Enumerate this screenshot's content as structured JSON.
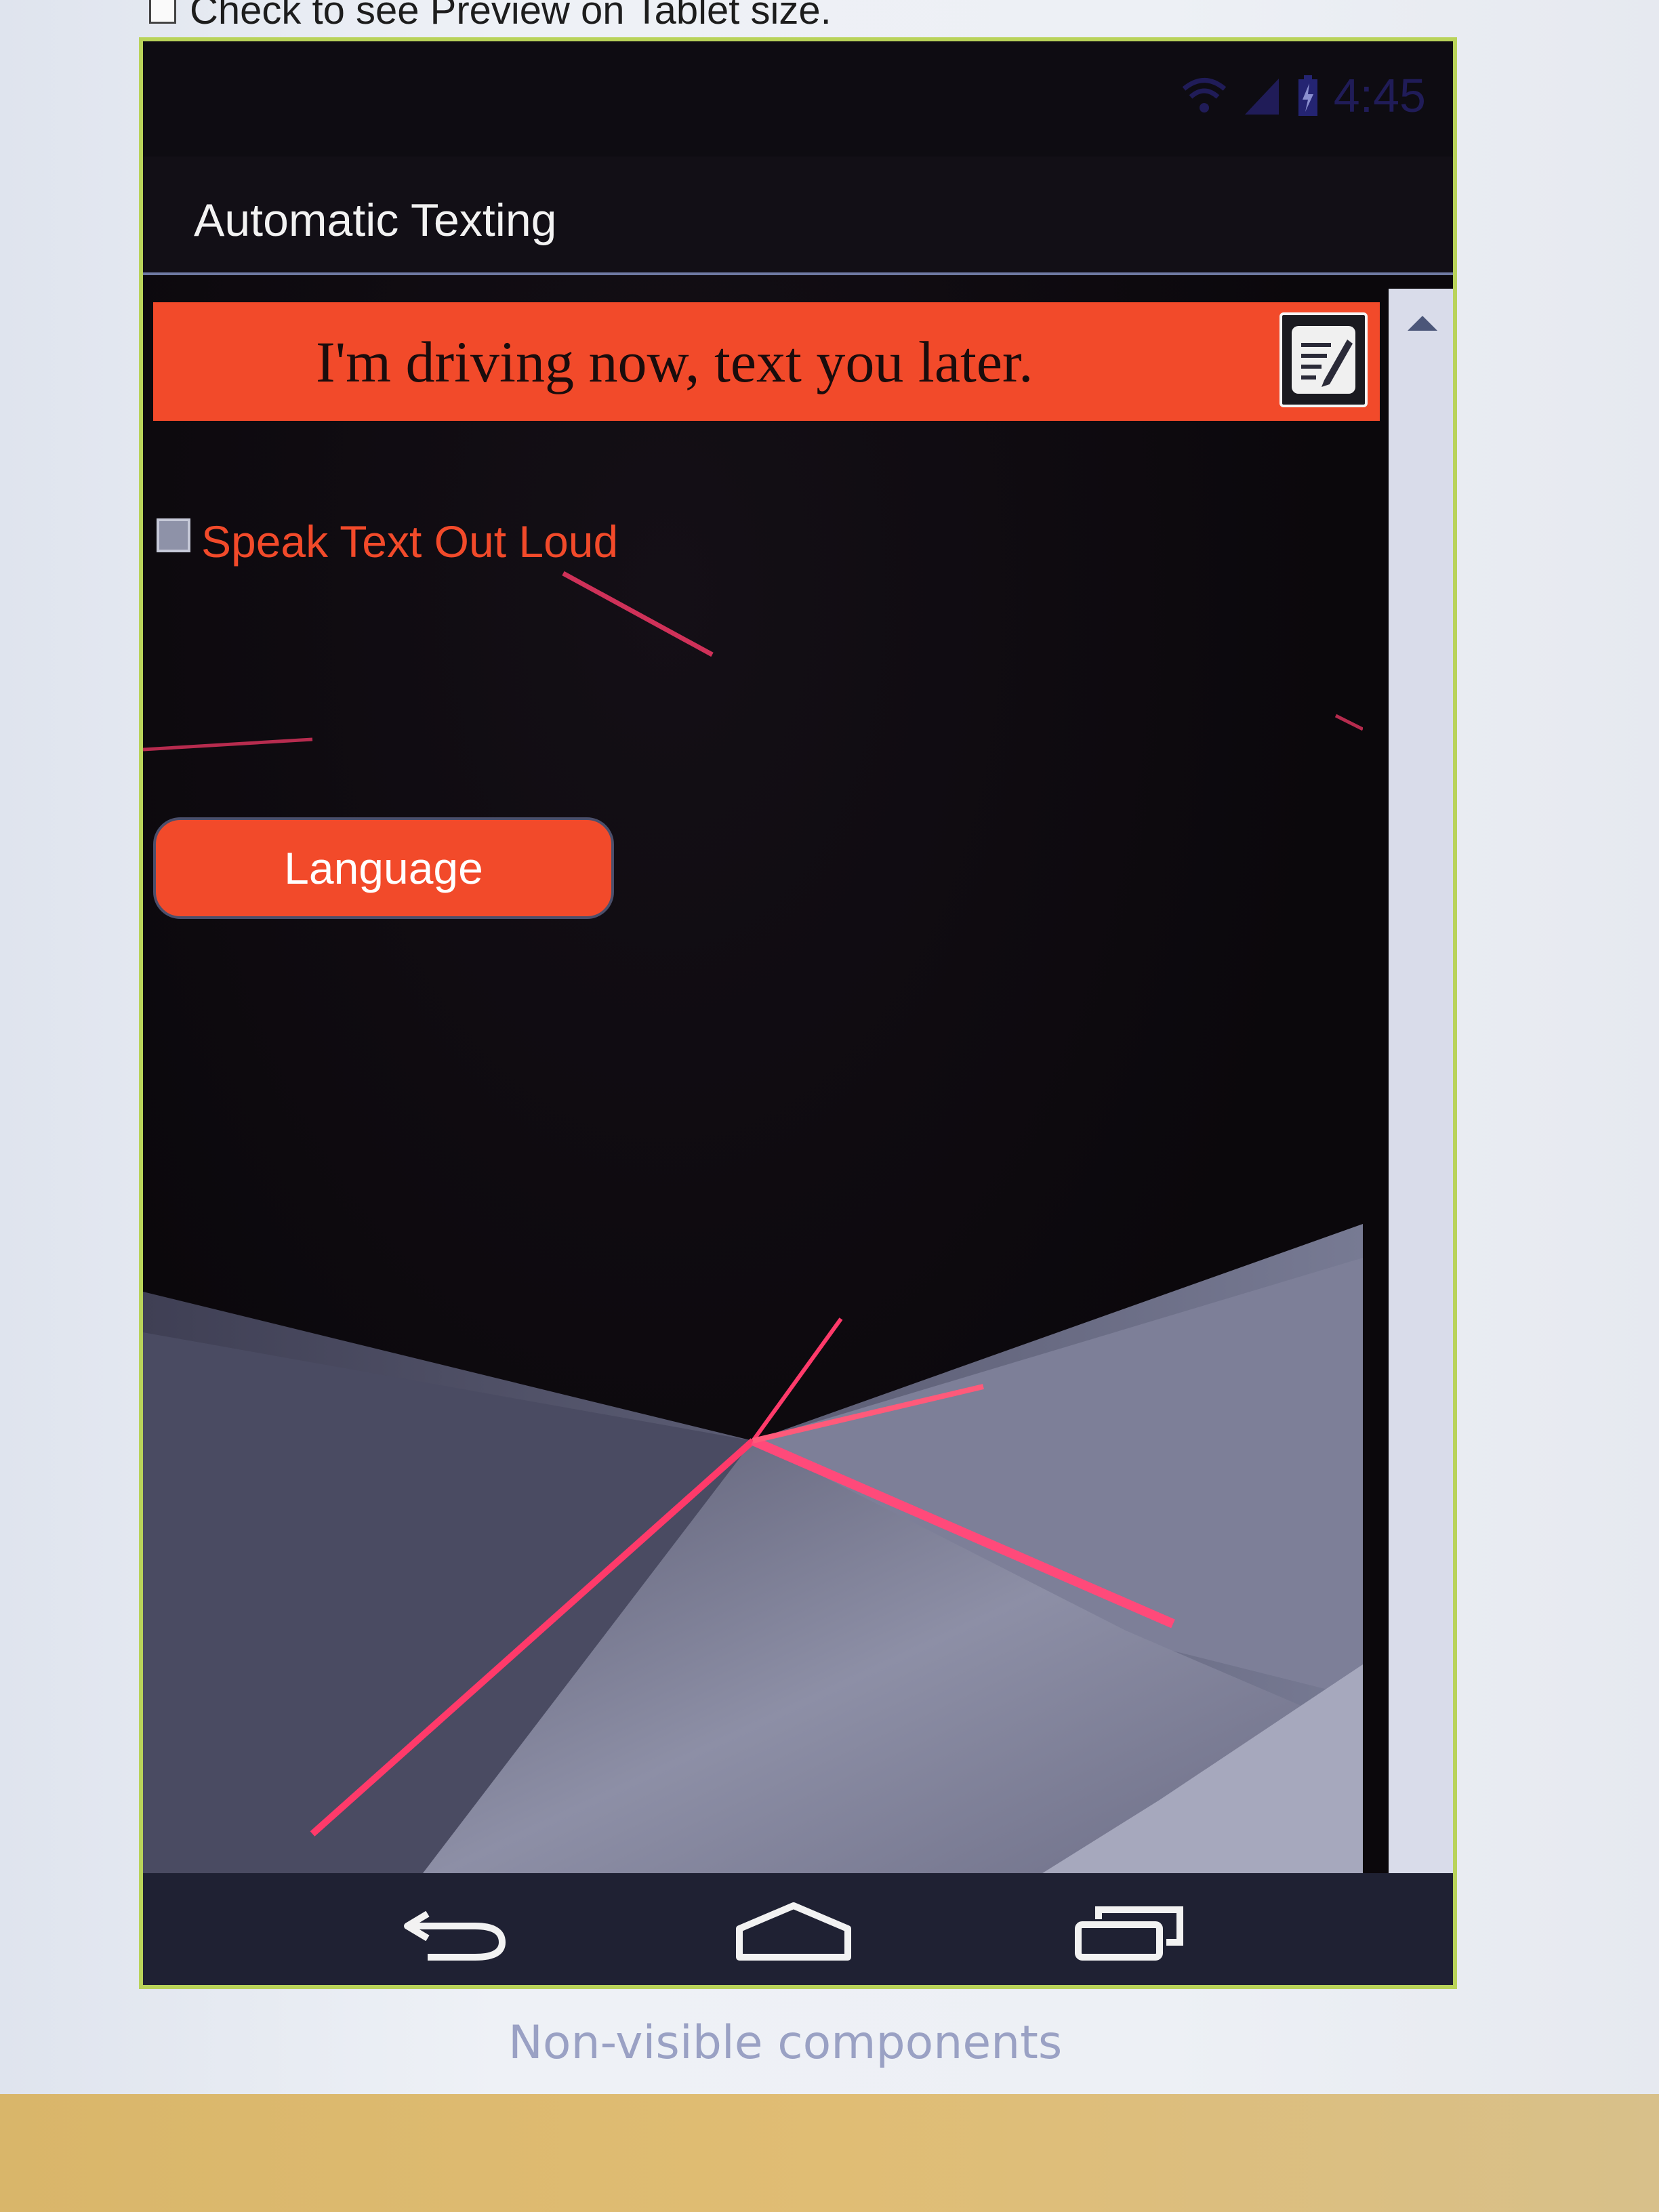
{
  "top_label": {
    "text": "Check to see Preview on Tablet size."
  },
  "status_bar": {
    "time": "4:45"
  },
  "action_bar": {
    "title": "Automatic Texting"
  },
  "message": {
    "text": "I'm driving now, text you later."
  },
  "speak_option": {
    "label": "Speak Text Out Loud",
    "checked": false
  },
  "language_button": {
    "label": "Language"
  },
  "footer": {
    "nonvisible_components": "Non-visible components"
  },
  "colors": {
    "accent": "#f24a2a",
    "phone_border": "#b9d35a",
    "nav_bar": "#1f2133"
  },
  "icons": [
    "wifi-icon",
    "signal-icon",
    "battery-icon",
    "edit-icon",
    "back-icon",
    "home-icon",
    "recents-icon"
  ]
}
